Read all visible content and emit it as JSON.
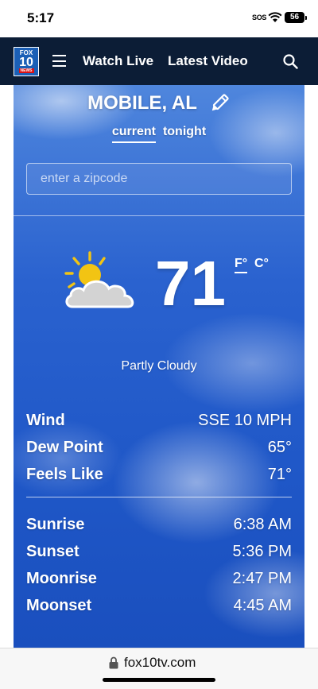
{
  "status_bar": {
    "time": "5:17",
    "sos": "SOS",
    "battery": "56"
  },
  "navbar": {
    "logo": {
      "line1": "FOX",
      "line2": "10",
      "line3": "NEWS"
    },
    "watch_live": "Watch Live",
    "latest_video": "Latest Video"
  },
  "weather": {
    "city": "MOBILE, AL",
    "tabs": [
      {
        "label": "current",
        "active": true
      },
      {
        "label": "tonight",
        "active": false
      }
    ],
    "zip_placeholder": "enter a zipcode",
    "temperature": "71",
    "unit_f": "F°",
    "unit_c": "C°",
    "condition": "Partly Cloudy",
    "stats": [
      {
        "label": "Wind",
        "value": "SSE 10 MPH"
      },
      {
        "label": "Dew Point",
        "value": "65°"
      },
      {
        "label": "Feels Like",
        "value": "71°"
      }
    ],
    "sun_moon": [
      {
        "label": "Sunrise",
        "value": "6:38 AM"
      },
      {
        "label": "Sunset",
        "value": "5:36 PM"
      },
      {
        "label": "Moonrise",
        "value": "2:47 PM"
      },
      {
        "label": "Moonset",
        "value": "4:45 AM"
      }
    ]
  },
  "url_bar": {
    "url": "fox10tv.com"
  },
  "colors": {
    "navbar": "#0c1d36",
    "sky": "#1e56c6",
    "sun": "#f2c413"
  }
}
